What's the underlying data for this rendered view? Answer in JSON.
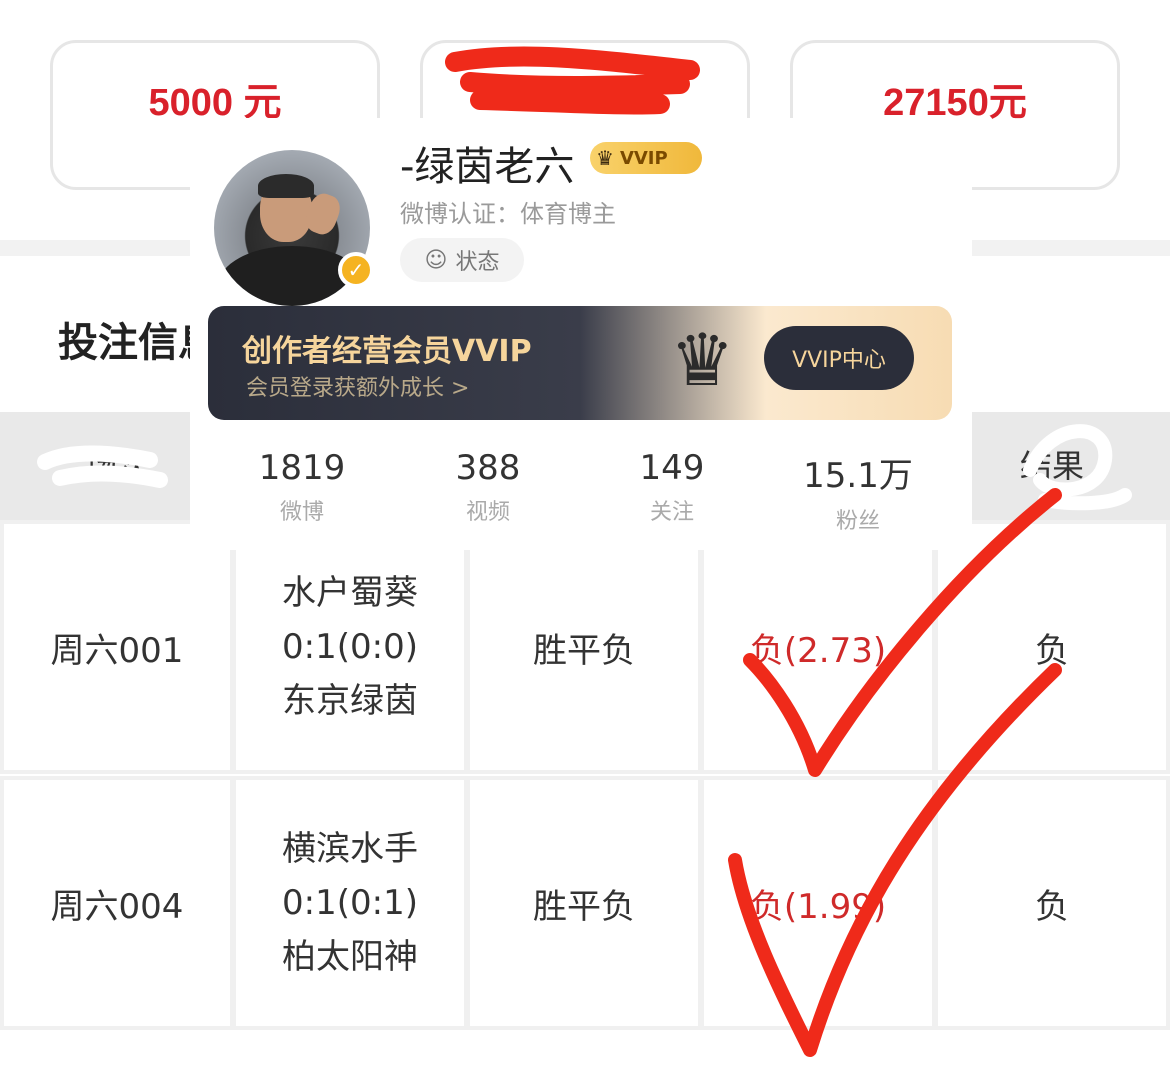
{
  "cards": [
    {
      "amount": "5000 元",
      "sub": ""
    },
    {
      "amount": "",
      "sub": ""
    },
    {
      "amount": "27150元",
      "sub": ""
    }
  ],
  "section": {
    "title": "投注信息"
  },
  "table": {
    "headers": [
      "场次",
      "",
      "",
      "",
      "结果"
    ],
    "rows": [
      {
        "id": "周六001",
        "home": "水户蜀葵",
        "score": "0:1(0:0)",
        "away": "东京绿茵",
        "play": "胜平负",
        "pick": "负(2.73)",
        "result": "负"
      },
      {
        "id": "周六004",
        "home": "横滨水手",
        "score": "0:1(0:1)",
        "away": "柏太阳神",
        "play": "胜平负",
        "pick": "负(1.99)",
        "result": "负"
      }
    ]
  },
  "profile": {
    "name": "-绿茵老六",
    "vip_badge": "VVIP",
    "verify": "微博认证：体育博主",
    "status": "状态",
    "banner_title": "创作者经营会员VVIP",
    "banner_sub": "会员登录获额外成长 >",
    "banner_button": "VVIP中心",
    "stats": [
      {
        "num": "1819",
        "label": "微博"
      },
      {
        "num": "388",
        "label": "视频"
      },
      {
        "num": "149",
        "label": "关注"
      },
      {
        "num": "15.1万",
        "label": "粉丝"
      }
    ]
  },
  "colors": {
    "accent_red": "#d9212b",
    "ink_red": "#ef2a1a",
    "gold": "#f6d59c"
  },
  "icons": {
    "verify": "verified-icon",
    "status": "status-icon",
    "crown": "crown-icon"
  }
}
